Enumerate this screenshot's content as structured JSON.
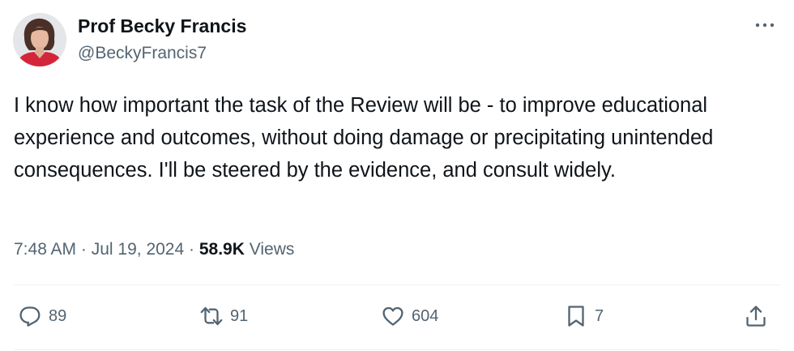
{
  "author": {
    "name": "Prof Becky Francis",
    "handle": "@BeckyFrancis7"
  },
  "post": {
    "text": "I know how important the task of the Review will be  - to improve educational experience and outcomes, without doing damage or precipitating unintended consequences. I'll be steered by the evidence, and consult widely.",
    "time": "7:48 AM",
    "date": "Jul 19, 2024",
    "views_count": "58.9K",
    "views_label": "Views"
  },
  "actions": {
    "replies": "89",
    "reposts": "91",
    "likes": "604",
    "bookmarks": "7"
  },
  "icons": {
    "more": "more-horizontal-icon",
    "reply": "reply-icon",
    "repost": "repost-icon",
    "like": "heart-icon",
    "bookmark": "bookmark-icon",
    "share": "share-icon"
  },
  "colors": {
    "text": "#0f1419",
    "secondary": "#536471",
    "divider": "#eff3f4"
  }
}
